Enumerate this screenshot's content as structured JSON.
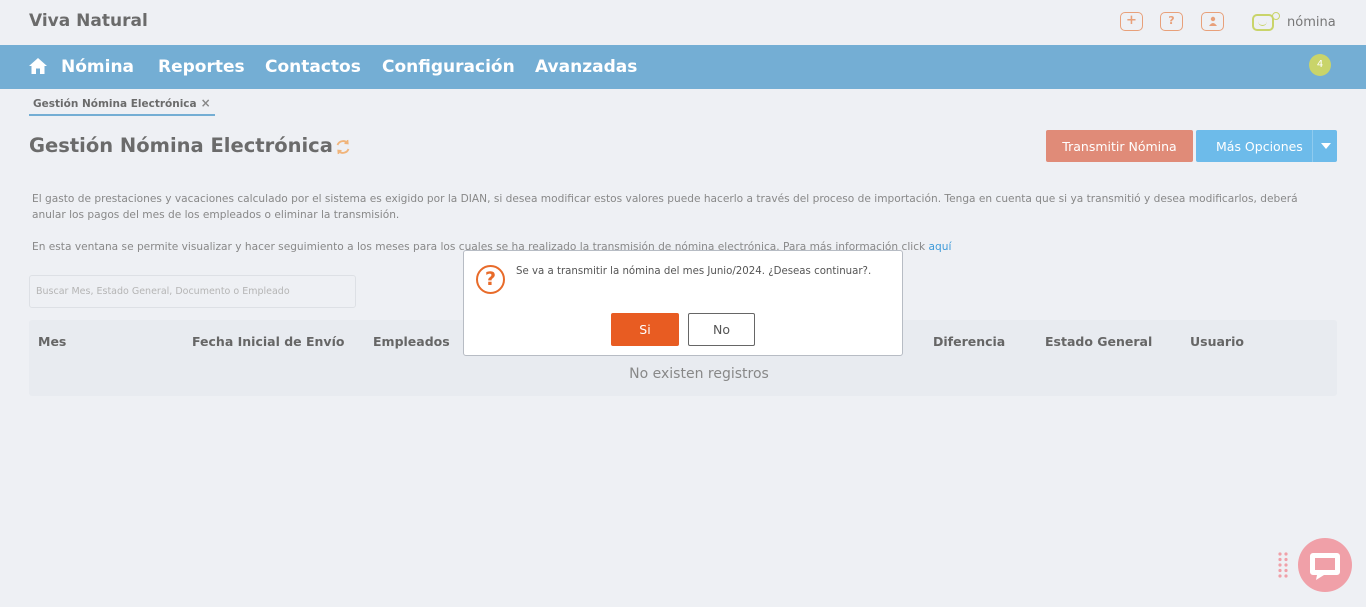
{
  "header": {
    "company": "Viva Natural",
    "icons": [
      "plus-icon",
      "help-icon",
      "user-icon"
    ],
    "logo_text": "nómina"
  },
  "nav": {
    "items": [
      "Nómina",
      "Reportes",
      "Contactos",
      "Configuración",
      "Avanzadas"
    ],
    "notification_count": "4"
  },
  "tab": {
    "label": "Gestión Nómina Electrónica",
    "close": "×"
  },
  "page": {
    "title": "Gestión Nómina Electrónica",
    "transmit_button": "Transmitir Nómina",
    "more_button": "Más Opciones"
  },
  "info": {
    "paragraph1": "El gasto de prestaciones y vacaciones calculado por el sistema es exigido por la DIAN, si desea modificar estos valores puede hacerlo a través del proceso de importación. Tenga en cuenta que si ya transmitió y desea modificarlos, deberá anular los pagos del mes de los empleados o eliminar la transmisión.",
    "paragraph2": "En esta ventana se permite visualizar y hacer seguimiento a los meses para los cuales se ha realizado la transmisión de nómina electrónica. Para más información click ",
    "link": "aquí"
  },
  "search": {
    "placeholder": "Buscar Mes, Estado General, Documento o Empleado",
    "value": ""
  },
  "table": {
    "columns": [
      "Mes",
      "Fecha Inicial de Envío",
      "Empleados",
      "Diferencia",
      "Estado General",
      "Usuario"
    ],
    "empty_message": "No existen registros"
  },
  "modal": {
    "icon": "?",
    "message": "Se va a transmitir la nómina del mes Junio/2024. ¿Deseas continuar?.",
    "yes": "Si",
    "no": "No"
  },
  "colors": {
    "nav": "#74aed4",
    "transmit": "#e08b78",
    "more": "#6dbbea",
    "confirm": "#e85c22"
  }
}
